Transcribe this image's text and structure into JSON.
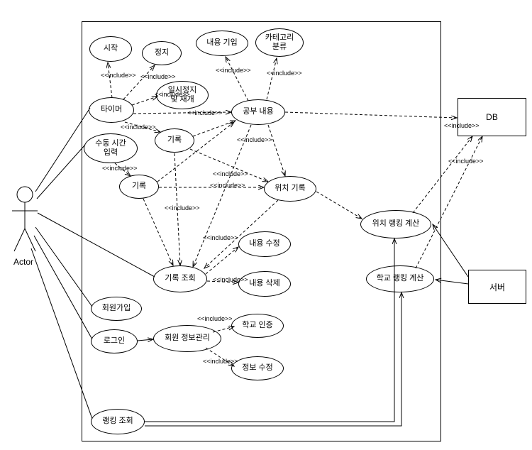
{
  "diagram_type": "uml-use-case",
  "actors": {
    "actor1": {
      "label": "Actor"
    }
  },
  "external": {
    "db": {
      "label": "DB"
    },
    "server": {
      "label": "서버"
    }
  },
  "usecases": {
    "start": "시작",
    "stop": "정지",
    "pause_resume": "일시정지\n및 재개",
    "content_entry": "내용 기입",
    "category": "카테고리\n분류",
    "timer": "타이머",
    "manual_time": "수동 시간\n입력",
    "record1": "기록",
    "record2": "기록",
    "study_content": "공부 내용",
    "location_record": "위치 기록",
    "record_view": "기록 조회",
    "edit_content": "내용 수정",
    "delete_content": "내용 삭제",
    "signup": "회원가입",
    "login": "로그인",
    "member_info": "회원 정보관리",
    "school_auth": "학교 인증",
    "info_edit": "정보 수정",
    "ranking_view": "랭킹 조회",
    "location_rank": "위치 랭킹 계산",
    "school_rank": "학교 랭킹 계산"
  },
  "relationship": {
    "include": "<<include>>"
  }
}
